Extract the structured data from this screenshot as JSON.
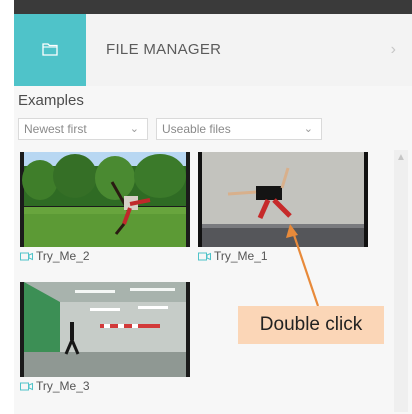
{
  "header": {
    "title": "FILE MANAGER",
    "chevron": "›"
  },
  "section": {
    "title": "Examples"
  },
  "filters": {
    "sort": "Newest first",
    "type": "Useable files"
  },
  "files": [
    {
      "name": "Try_Me_2"
    },
    {
      "name": "Try_Me_1"
    },
    {
      "name": "Try_Me_3"
    }
  ],
  "annotation": {
    "text": "Double click"
  },
  "icons": {
    "folder": "folder-icon",
    "camera": "video-camera-icon",
    "chevron": "chevron-right-icon"
  },
  "colors": {
    "accent": "#4fc3c9",
    "annotation_bg": "#fbd6b7",
    "annotation_arrow": "#e88a3a"
  }
}
